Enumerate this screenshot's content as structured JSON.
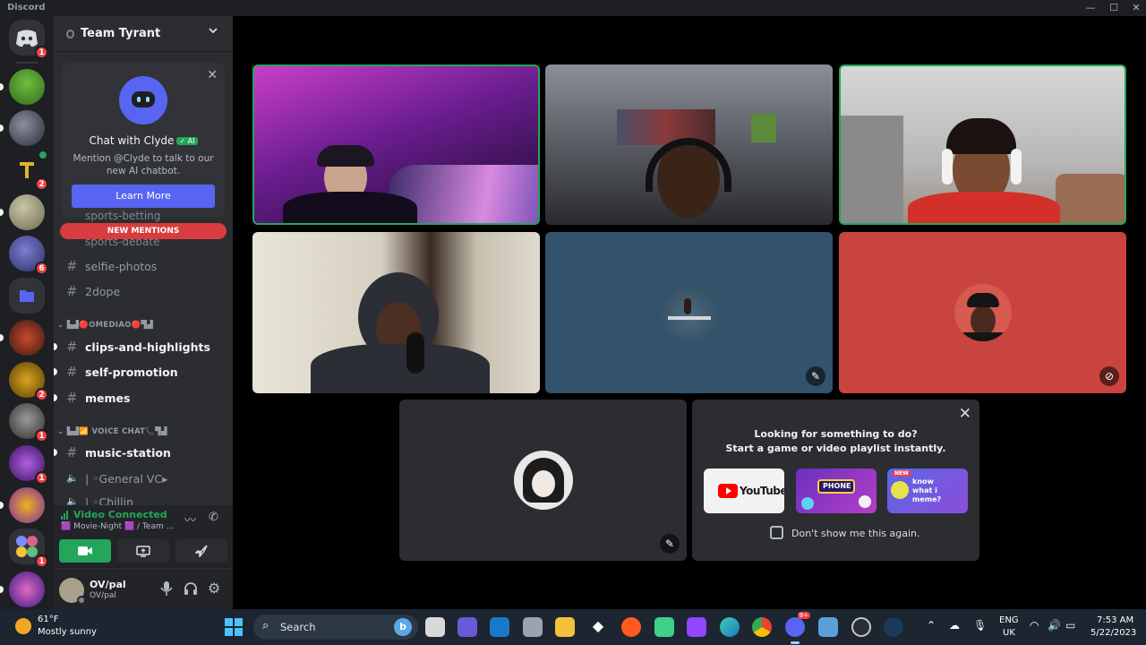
{
  "window": {
    "app_title": "Discord",
    "minimize": "—",
    "maximize": "☐",
    "close": "✕"
  },
  "servers": [
    {
      "badge": "1"
    },
    {
      "badge": ""
    },
    {
      "badge": ""
    },
    {
      "badge": "2"
    },
    {
      "badge": ""
    },
    {
      "badge": "6"
    },
    {
      "badge": ""
    },
    {
      "badge": ""
    },
    {
      "badge": "2"
    },
    {
      "badge": "1"
    },
    {
      "badge": "1"
    },
    {
      "badge": ""
    },
    {
      "badge": "1"
    },
    {
      "badge": ""
    }
  ],
  "server_header": {
    "name": "Team Tyrant"
  },
  "clyde": {
    "title": "Chat with Clyde",
    "ai_tag": "✓ AI",
    "description": "Mention @Clyde to talk to our new AI chatbot.",
    "button": "Learn More"
  },
  "partial_channels": [
    "sports-betting",
    "sports-debate"
  ],
  "new_mentions": "NEW MENTIONS",
  "channels_top": [
    "selfie-photos",
    "2dope"
  ],
  "category_media": "▙▟🔴✪MEDIA✪🔴▜▟",
  "channels_media": [
    "clips-and-highlights",
    "self-promotion",
    "memes"
  ],
  "category_voice": "▙▟📶 VOICE CHAT📞▜▟",
  "channels_voice": [
    {
      "icon": "#",
      "name": "music-station"
    },
    {
      "icon": "🔈",
      "name": "| ◦General VC▸"
    },
    {
      "icon": "🔈",
      "name": "| ◦Chillin"
    }
  ],
  "voice_panel": {
    "status": "Video Connected",
    "channel": "🟪 Movie-Night 🟪 / Team ..."
  },
  "user": {
    "name": "OV/pal",
    "status": "OV/pal"
  },
  "activity": {
    "line1": "Looking for something to do?",
    "line2": "Start a game or video playlist instantly.",
    "youtube_label": "YouTube",
    "phone_label": "PHONE",
    "meme_label": "know what i meme?",
    "new_label": "NEW",
    "dont_show": "Don't show me this again."
  },
  "taskbar": {
    "temperature": "61°F",
    "weather": "Mostly sunny",
    "search": "Search",
    "bing": "b",
    "lang1": "ENG",
    "lang2": "UK",
    "time": "7:53 AM",
    "date": "5/22/2023",
    "discord_badge": "9+"
  },
  "colors": {
    "accent": "#5865f2",
    "online_green": "#23a55a",
    "mention_red": "#d83c3e",
    "red_tile": "#c9443f",
    "blue_tile": "#33526b"
  }
}
